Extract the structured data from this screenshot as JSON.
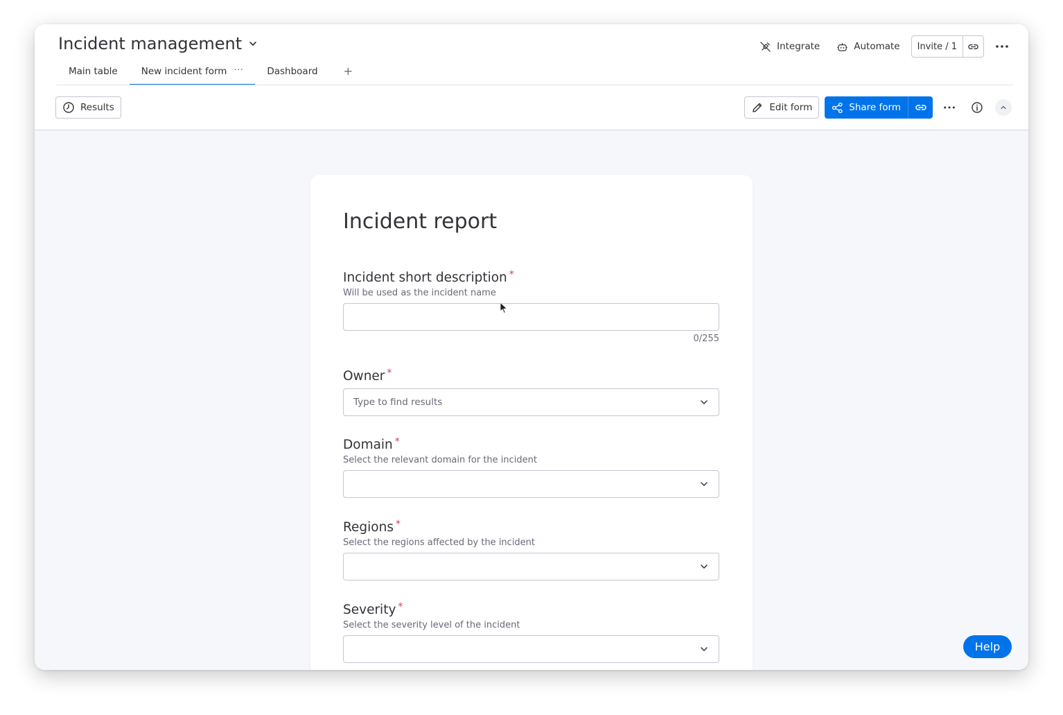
{
  "board": {
    "title": "Incident management"
  },
  "tabs": [
    {
      "label": "Main table"
    },
    {
      "label": "New incident form",
      "menu": "···"
    },
    {
      "label": "Dashboard"
    }
  ],
  "tab_add": "+",
  "top_actions": {
    "integrate": "Integrate",
    "automate": "Automate",
    "invite": "Invite / 1"
  },
  "toolbar": {
    "results": "Results",
    "edit_form": "Edit form",
    "share_form": "Share form"
  },
  "form": {
    "title": "Incident report",
    "fields": {
      "short_description": {
        "label": "Incident short description",
        "required": "*",
        "description": "Will be used as the incident name",
        "value": "",
        "counter": "0/255"
      },
      "owner": {
        "label": "Owner",
        "required": "*",
        "placeholder": "Type to find results"
      },
      "domain": {
        "label": "Domain",
        "required": "*",
        "description": "Select the relevant domain for the incident"
      },
      "regions": {
        "label": "Regions",
        "required": "*",
        "description": "Select the regions affected by the incident"
      },
      "severity": {
        "label": "Severity",
        "required": "*",
        "description": "Select the severity level of the incident"
      }
    }
  },
  "help": "Help",
  "colors": {
    "primary": "#0073ea",
    "required": "#d83a52",
    "text": "#323338",
    "muted": "#676879",
    "background": "#f6f7fb"
  },
  "icons": [
    "chevron-down-icon",
    "integrate-icon",
    "robot-icon",
    "link-icon",
    "more-icon",
    "clock-icon",
    "pencil-icon",
    "share-icon",
    "info-icon",
    "chevron-up-icon",
    "mouse-cursor-icon"
  ]
}
